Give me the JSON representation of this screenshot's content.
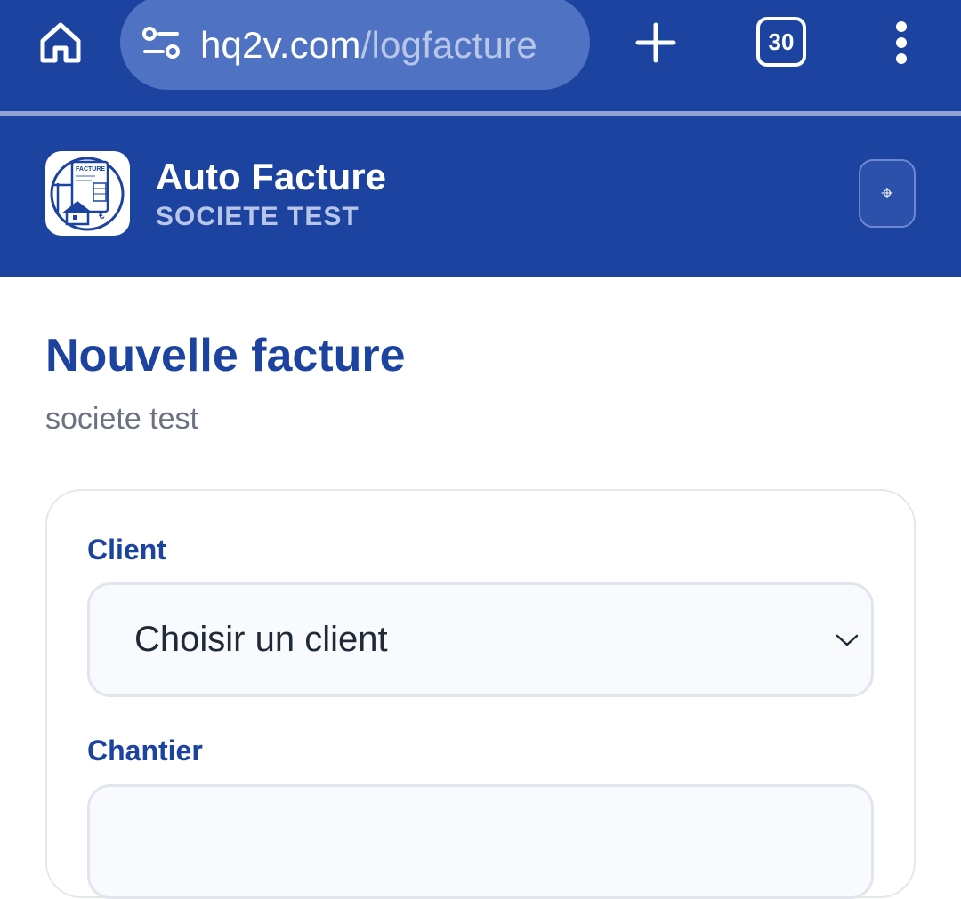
{
  "browser": {
    "url_domain": "hq2v.com",
    "url_path": "/logfacture",
    "tab_count": "30",
    "icons": {
      "home": "home-icon",
      "site_settings": "tune-icon",
      "new_tab": "plus-icon",
      "menu": "more-vertical-icon"
    }
  },
  "header": {
    "app_name": "Auto Facture",
    "company": "SOCIETE TEST",
    "logo_text": "FACTURE",
    "menu_glyph": "⌖"
  },
  "main": {
    "title": "Nouvelle facture",
    "subtitle": "societe test",
    "form": {
      "client_label": "Client",
      "client_select_value": "Choisir un client",
      "chantier_label": "Chantier",
      "chantier_value": ""
    }
  },
  "colors": {
    "primary": "#1c43a0",
    "url_pill": "#4f73c2",
    "muted_text": "#6b7280",
    "field_bg": "#f8fafd"
  }
}
